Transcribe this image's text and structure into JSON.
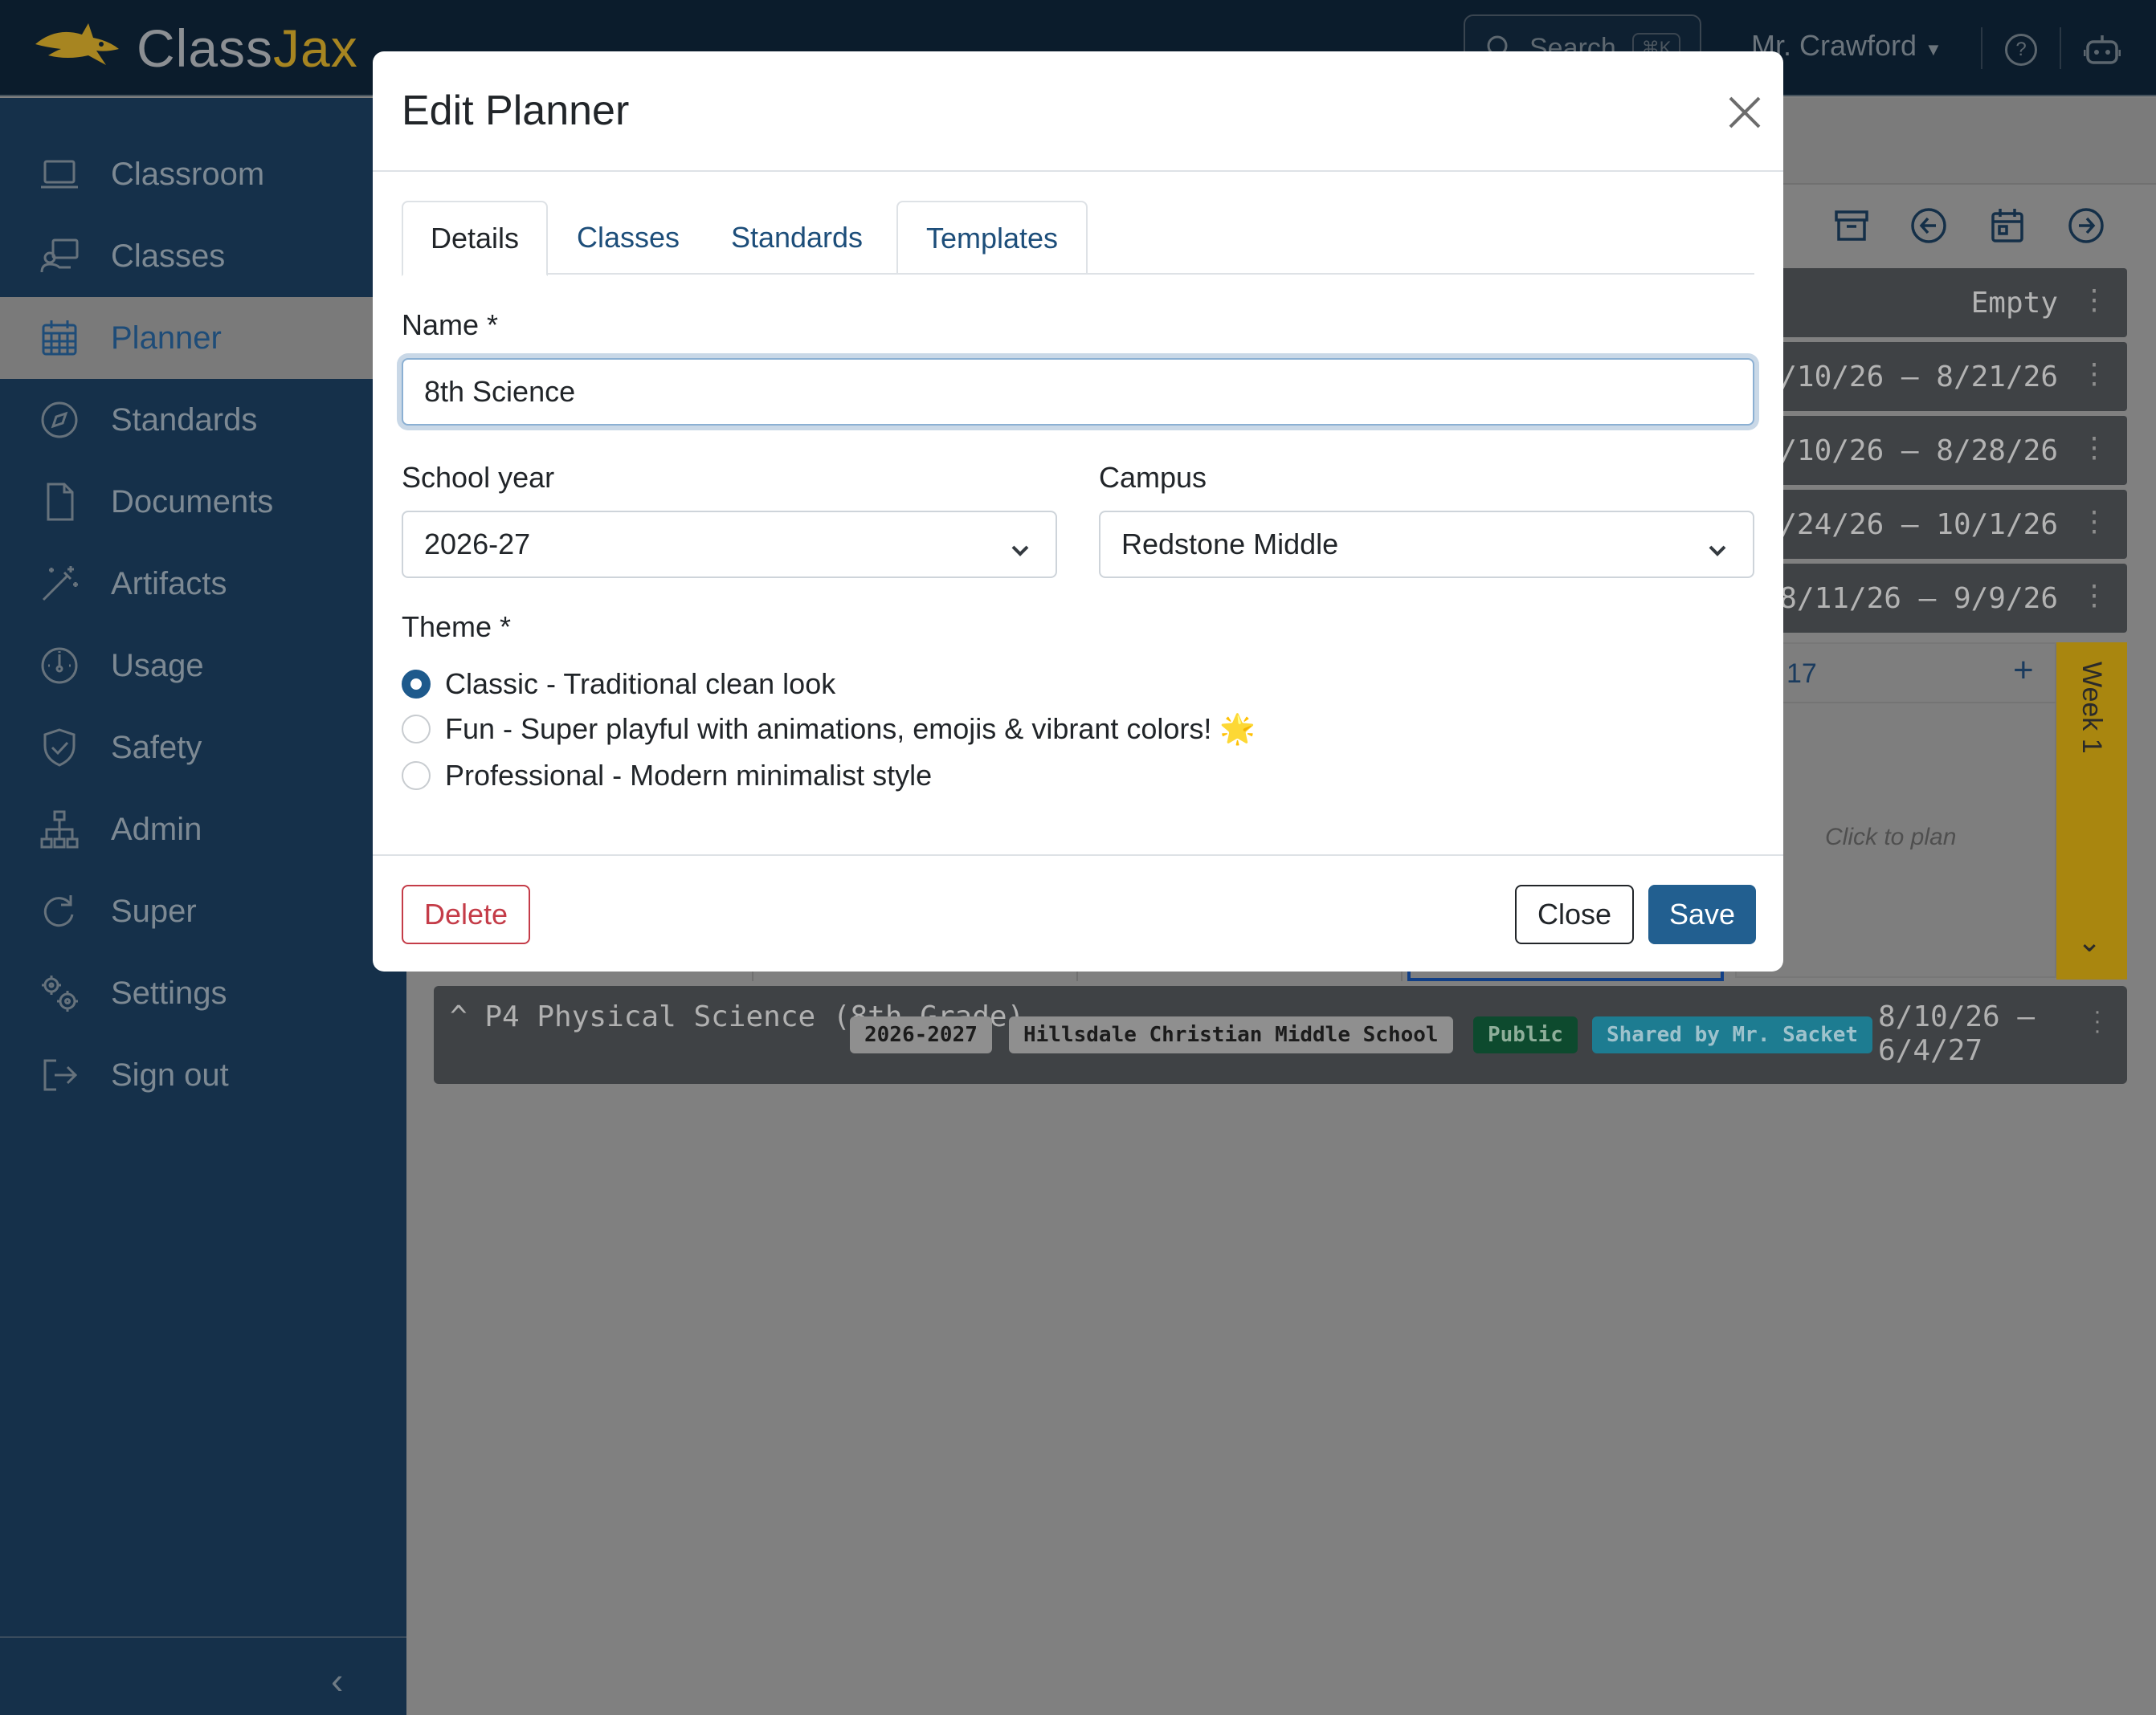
{
  "app": {
    "logo_prefix": "Class",
    "logo_suffix": "Jax",
    "search_placeholder": "Search",
    "search_shortcut": "⌘K",
    "user_name": "Mr. Crawford"
  },
  "sidebar": {
    "items": [
      {
        "label": "Classroom",
        "icon": "laptop-icon",
        "active": false
      },
      {
        "label": "Classes",
        "icon": "teacher-board-icon",
        "active": false
      },
      {
        "label": "Planner",
        "icon": "calendar-grid-icon",
        "active": true
      },
      {
        "label": "Standards",
        "icon": "compass-icon",
        "active": false
      },
      {
        "label": "Documents",
        "icon": "document-icon",
        "active": false
      },
      {
        "label": "Artifacts",
        "icon": "magic-wand-icon",
        "active": false
      },
      {
        "label": "Usage",
        "icon": "gauge-icon",
        "active": false
      },
      {
        "label": "Safety",
        "icon": "shield-check-icon",
        "active": false
      },
      {
        "label": "Admin",
        "icon": "org-chart-icon",
        "active": false
      },
      {
        "label": "Super",
        "icon": "refresh-icon",
        "active": false
      },
      {
        "label": "Settings",
        "icon": "gears-icon",
        "active": false
      },
      {
        "label": "Sign out",
        "icon": "sign-out-icon",
        "active": false
      }
    ],
    "collapse_glyph": "‹"
  },
  "background": {
    "rows": [
      {
        "text": "Empty"
      },
      {
        "text": "/10/26 – 8/21/26"
      },
      {
        "text": "/10/26 – 8/28/26"
      },
      {
        "text": "/24/26 – 10/1/26"
      },
      {
        "text": "8/11/26 – 9/9/26"
      }
    ],
    "day_number": "17",
    "click_to_plan": "Click to plan",
    "week_label": "Week 1",
    "planner": {
      "title": "P4 Physical Science (8th Grade)",
      "year_pill": "2026-2027",
      "school_pill": "Hillsdale Christian Middle School",
      "visibility_pill": "Public",
      "shared_pill": "Shared by Mr. Sacket",
      "dates": "8/10/26 – 6/4/27"
    }
  },
  "modal": {
    "title": "Edit Planner",
    "tabs": [
      {
        "label": "Details",
        "active": true
      },
      {
        "label": "Classes",
        "active": false
      },
      {
        "label": "Standards",
        "active": false
      },
      {
        "label": "Templates",
        "active": false
      }
    ],
    "name_label": "Name *",
    "name_value": "8th Science",
    "school_year_label": "School year",
    "school_year_value": "2026-27",
    "campus_label": "Campus",
    "campus_value": "Redstone Middle",
    "theme_label": "Theme *",
    "themes": [
      {
        "label": "Classic - Traditional clean look",
        "checked": true
      },
      {
        "label": "Fun - Super playful with animations, emojis & vibrant colors!",
        "checked": false,
        "emoji": "🌟"
      },
      {
        "label": "Professional - Modern minimalist style",
        "checked": false
      }
    ],
    "delete_label": "Delete",
    "close_label": "Close",
    "save_label": "Save"
  },
  "colors": {
    "primary": "#225f90",
    "danger": "#c43c48",
    "sidebar_bg": "#15304a",
    "topbar_bg": "#0b1c2c",
    "week_tab": "#a9860f"
  }
}
